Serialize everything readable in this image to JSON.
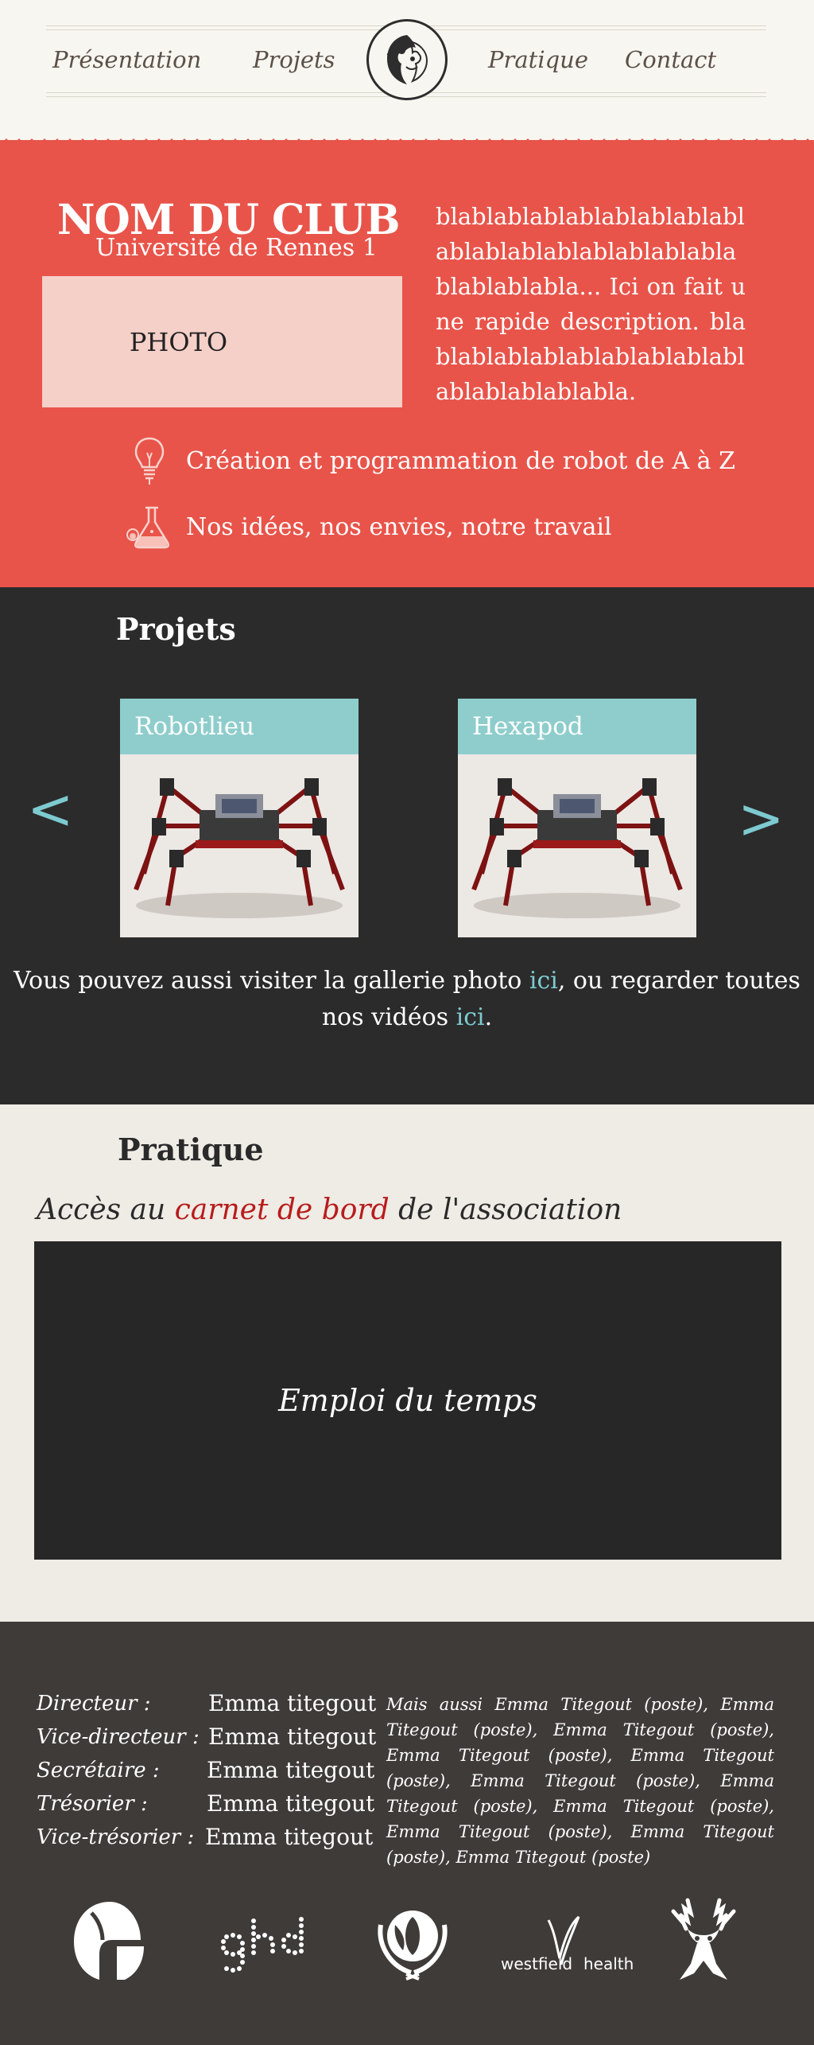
{
  "nav": {
    "items": [
      "Présentation",
      "Projets",
      "Pratique",
      "Contact"
    ]
  },
  "hero": {
    "club_name": "NOM DU CLUB",
    "university": "Université de Rennes 1",
    "photo_label": "PHOTO",
    "description": "blablablablablablablablablablablablablablablablablablablablabla... Ici on fait une rapide description. blablablablablablablablablablablablablablabla.",
    "features": [
      {
        "icon": "lightbulb-icon",
        "text": "Création et programmation de robot de A à Z"
      },
      {
        "icon": "flask-icon",
        "text": "Nos idées, nos envies, notre travail"
      }
    ]
  },
  "projets": {
    "title": "Projets",
    "prev_arrow": "<",
    "next_arrow": ">",
    "cards": [
      {
        "title": "Robotlieu"
      },
      {
        "title": "Hexapod"
      }
    ],
    "visit": {
      "part1": "Vous pouvez aussi visiter la gallerie photo ",
      "link1": "ici",
      "part2": ", ou regarder toutes nos vidéos ",
      "link2": "ici",
      "part3": "."
    }
  },
  "pratique": {
    "title": "Pratique",
    "carnet": {
      "prefix": "Accès au ",
      "link": "carnet de bord",
      "suffix": " de l'association"
    },
    "schedule_label": "Emploi du temps"
  },
  "footer": {
    "roles": [
      {
        "role": "Directeur :",
        "name": "Emma titegout"
      },
      {
        "role": "Vice-directeur :",
        "name": "Emma titegout"
      },
      {
        "role": "Secrétaire :",
        "name": "Emma titegout"
      },
      {
        "role": "Trésorier :",
        "name": "Emma titegout"
      },
      {
        "role": "Vice-trésorier :",
        "name": "Emma titegout"
      }
    ],
    "also": "Mais aussi Emma Titegout (poste), Emma Titegout (poste), Emma Titegout (poste), Emma Titegout (poste), Emma Titegout (poste), Emma Titegout (poste), Emma Titegout (poste), Emma Titegout (poste), Emma Titegout (poste), Emma Titegout (poste), Emma Titegout (poste)",
    "sponsors": [
      "spartan-helmet-logo",
      "ghd",
      "un-emblem-logo",
      "westfield health",
      "stag-logo"
    ]
  },
  "colors": {
    "hero_red": "#e8544a",
    "teal": "#7dcad0",
    "card_header": "#8ecdcc",
    "link_red": "#b71c1c",
    "dark_bg": "#2b2b2b",
    "footer_bg": "#3f3b39"
  }
}
